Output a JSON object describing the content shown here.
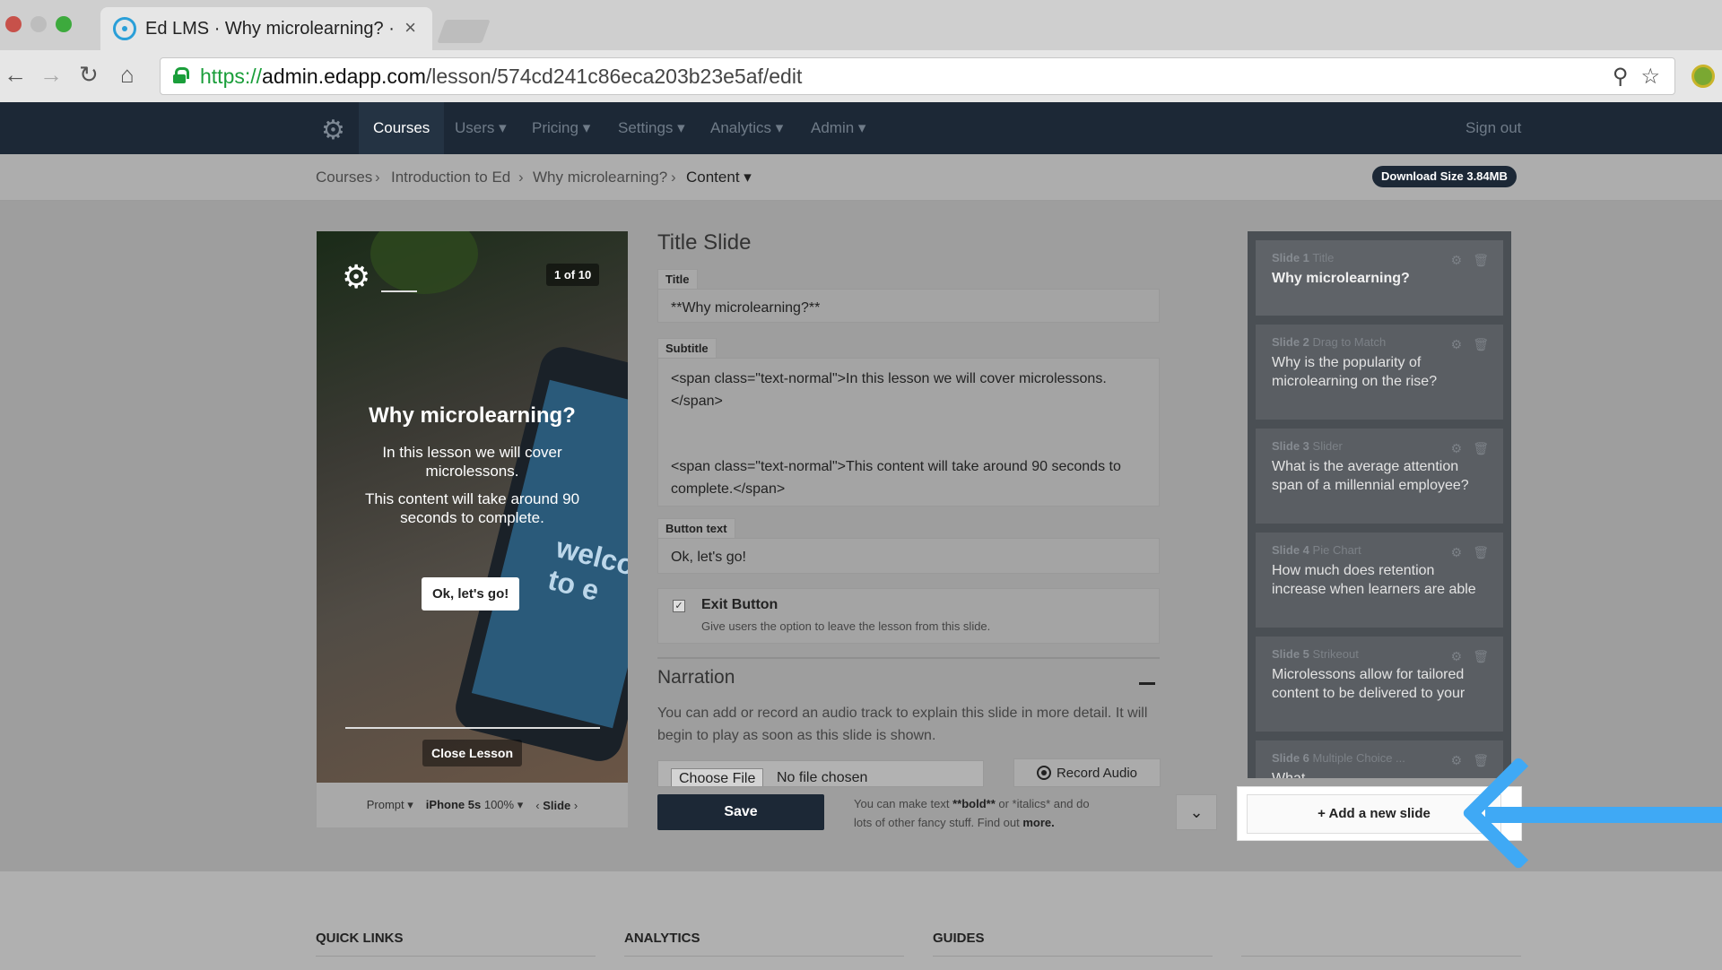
{
  "browser": {
    "tab_title": "Ed LMS · Why microlearning? ·",
    "url_scheme": "https://",
    "url_host": "admin.edapp.com",
    "url_path": "/lesson/574cd241c86eca203b23e5af/edit",
    "icons": [
      "back-icon",
      "forward-icon",
      "reload-icon",
      "home-icon",
      "zoom-icon",
      "bookmark-star-icon"
    ]
  },
  "nav": {
    "items": [
      "Courses",
      "Users",
      "Pricing",
      "Settings",
      "Analytics",
      "Admin"
    ],
    "sign_out": "Sign out",
    "active": "Courses"
  },
  "breadcrumb": {
    "items": [
      "Courses",
      "Introduction to Ed",
      "Why microlearning?",
      "Content"
    ],
    "download_size": "Download Size 3.84MB"
  },
  "preview": {
    "counter": "1 of 10",
    "title": "Why microlearning?",
    "subtitle_1": "In this lesson we will cover microlessons.",
    "subtitle_2": "This content will take around 90 seconds to complete.",
    "button": "Ok, let's go!",
    "close": "Close Lesson",
    "bg_text": "welco to e",
    "bar": {
      "prompt": "Prompt",
      "device": "iPhone 5s",
      "zoom": "100%",
      "slide": "Slide"
    }
  },
  "editor": {
    "heading": "Title Slide",
    "title_label": "Title",
    "title_value": "**Why microlearning?**",
    "subtitle_label": "Subtitle",
    "subtitle_line1": "<span class=\"text-normal\">In this lesson we will cover microlessons.",
    "subtitle_line2": "</span>",
    "subtitle_line3": "<span class=\"text-normal\">This content will take around 90 seconds to",
    "subtitle_line4": "complete.</span>",
    "button_label": "Button text",
    "button_value": "Ok, let's go!",
    "exit_checked": true,
    "exit_title": "Exit Button",
    "exit_desc": "Give users the option to leave the lesson from this slide.",
    "narration_title": "Narration",
    "narration_desc": "You can add or record an audio track to explain this slide in more detail. It will begin to play as soon as this slide is shown.",
    "choose_file": "Choose File",
    "no_file": "No file chosen",
    "record_audio": "Record Audio",
    "save": "Save",
    "hint_prefix": "You can make text ",
    "hint_bold": "**bold**",
    "hint_mid": " or *italics* and do lots of other fancy stuff. Find out ",
    "hint_more": "more."
  },
  "slides": [
    {
      "num": "Slide 1",
      "type": "Title",
      "title": "Why microlearning?"
    },
    {
      "num": "Slide 2",
      "type": "Drag to Match",
      "title": "Why is the popularity of microlearning on the rise?"
    },
    {
      "num": "Slide 3",
      "type": "Slider",
      "title": "What is the average attention span of a millennial employee?"
    },
    {
      "num": "Slide 4",
      "type": "Pie Chart",
      "title": "How much does retention increase when learners are able"
    },
    {
      "num": "Slide 5",
      "type": "Strikeout",
      "title": "Microlessons allow for tailored content to be delivered to your"
    },
    {
      "num": "Slide 6",
      "type": "Multiple Choice ...",
      "title": "What..."
    }
  ],
  "add_slide": "+ Add a new slide",
  "footer": {
    "quick_links": "QUICK LINKS",
    "analytics": "ANALYTICS",
    "guides": "GUIDES"
  },
  "colors": {
    "nav_bg": "#1c2836",
    "accent_arrow": "#3fa9f5",
    "url_green": "#1a9e3a"
  }
}
